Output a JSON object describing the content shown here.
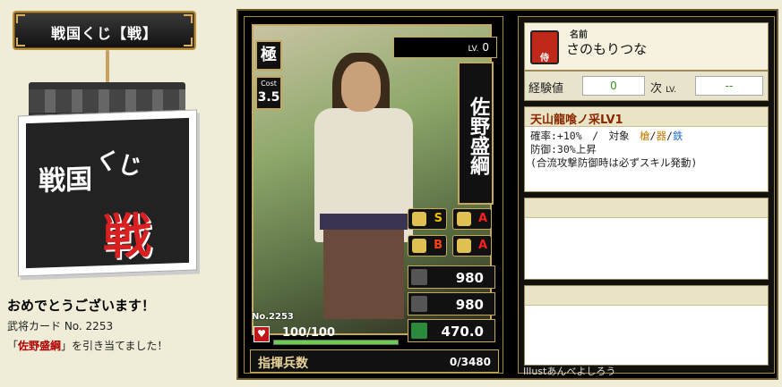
{
  "header": {
    "title": "戦国くじ【戦】"
  },
  "book": {
    "text1": "戦国",
    "text2": "くじ",
    "text3": "戦"
  },
  "result": {
    "congrats": "おめでとうございます！",
    "card_label": "武将カード No. 2253",
    "prefix": "「",
    "general": "佐野盛綱",
    "suffix": "」を引き当てました！"
  },
  "card": {
    "rank": "極",
    "cost_label": "Cost",
    "cost": "3.5",
    "lv_label": "LV.",
    "lv": "0",
    "name": "佐野盛綱",
    "skills": [
      {
        "icon": "spear-icon",
        "rank": "S"
      },
      {
        "icon": "horse-icon",
        "rank": "A"
      },
      {
        "icon": "bow-icon",
        "rank": "B"
      },
      {
        "icon": "gun-icon",
        "rank": "A"
      }
    ],
    "stats": {
      "attack": "980",
      "defense": "980",
      "speed": "470.0"
    },
    "number": "No.2253",
    "hp_current": 100,
    "hp_max": 100,
    "hp_text": "100/100",
    "command_label": "指揮兵数",
    "command_value": "0/3480"
  },
  "profile": {
    "seal_char": "侍",
    "name_label": "名前",
    "name_reading": "さのもりつな",
    "exp_label": "経験値",
    "exp_value": "0",
    "next_label": "次",
    "next_lv_label": "LV.",
    "next_value": "--"
  },
  "skill1": {
    "name": "天山龍喰ノ采LV1",
    "line1_a": "確率:+10%　/　対象　",
    "t1": "槍",
    "sep1": "/",
    "t2": "器",
    "sep2": "/",
    "t3": "鉄",
    "line2": "防御:30%上昇",
    "line3": "(合流攻撃防御時は必ずスキル発動)"
  },
  "illust": {
    "text": "Illustあんべよしろう"
  },
  "colors": {
    "gold": "#c6a85a",
    "background": "#efecd8",
    "red": "#c01818"
  }
}
